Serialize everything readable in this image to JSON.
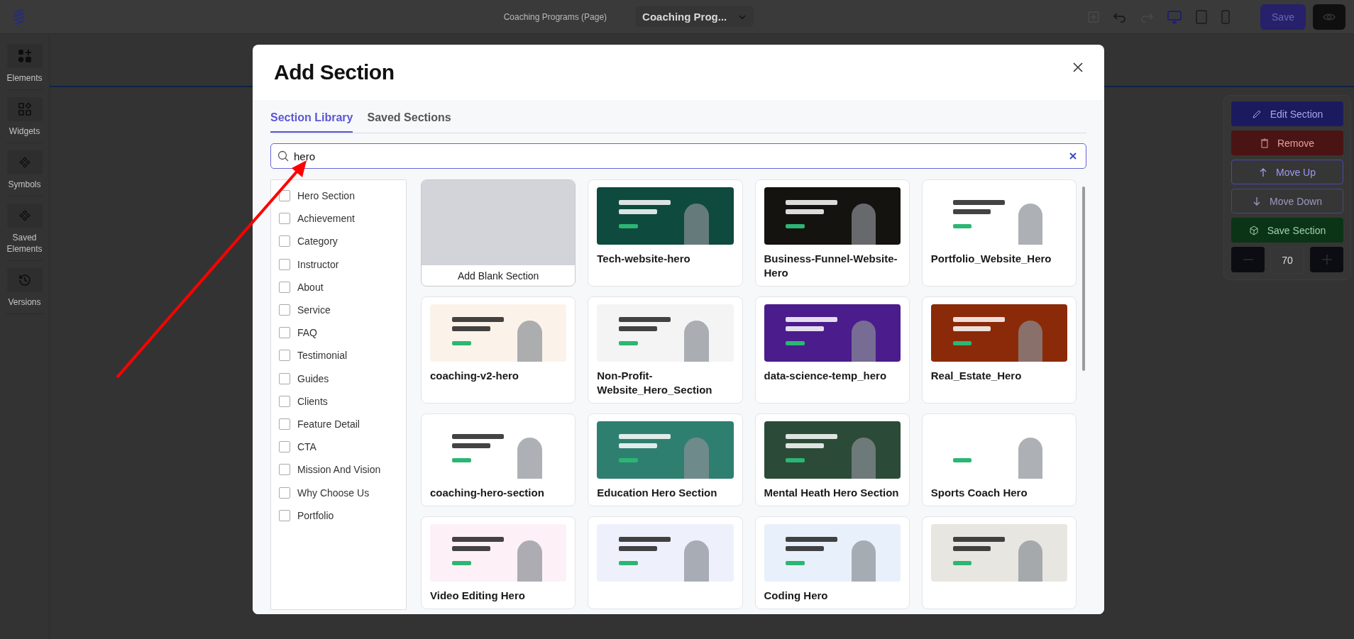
{
  "top_bar": {
    "page_label": "Coaching Programs (Page)",
    "page_select": "Coaching Prog...",
    "save_button": "Save"
  },
  "sidebar": {
    "items": [
      {
        "label": "Elements"
      },
      {
        "label": "Widgets"
      },
      {
        "label": "Symbols"
      },
      {
        "label": "Saved Elements"
      },
      {
        "label": "Versions"
      }
    ]
  },
  "section_panel": {
    "buttons": [
      {
        "label": "Edit Section",
        "kind": "edit"
      },
      {
        "label": "Remove",
        "kind": "remove"
      },
      {
        "label": "Move Up",
        "kind": "up"
      },
      {
        "label": "Move Down",
        "kind": "down"
      },
      {
        "label": "Save Section",
        "kind": "save"
      }
    ],
    "width_value": "70"
  },
  "modal": {
    "title": "Add Section",
    "tabs": [
      {
        "label": "Section Library",
        "selected": true
      },
      {
        "label": "Saved Sections",
        "selected": false
      }
    ],
    "search": {
      "value": "hero"
    },
    "categories": [
      {
        "label": "Hero Section",
        "checked": false
      },
      {
        "label": "Achievement",
        "checked": false
      },
      {
        "label": "Category",
        "checked": false
      },
      {
        "label": "Instructor",
        "checked": false
      },
      {
        "label": "About",
        "checked": false
      },
      {
        "label": "Service",
        "checked": false
      },
      {
        "label": "FAQ",
        "checked": false
      },
      {
        "label": "Testimonial",
        "checked": false
      },
      {
        "label": "Guides",
        "checked": false
      },
      {
        "label": "Clients",
        "checked": false
      },
      {
        "label": "Feature Detail",
        "checked": false
      },
      {
        "label": "CTA",
        "checked": false
      },
      {
        "label": "Mission And Vision",
        "checked": false
      },
      {
        "label": "Why Choose Us",
        "checked": false
      },
      {
        "label": "Portfolio",
        "checked": false
      }
    ],
    "blank_section": "Add Blank Section",
    "templates": [
      {
        "kind": "titled",
        "title": "Tech-website-hero"
      },
      {
        "kind": "titled",
        "title": "Business-Funnel-Website-Hero"
      },
      {
        "kind": "titled",
        "title": "Portfolio_Website_Hero"
      },
      {
        "kind": "titled",
        "title": "coaching-v2-hero"
      },
      {
        "kind": "titled",
        "title": "Non-Profit-Website_Hero_Section"
      },
      {
        "kind": "titled",
        "title": "data-science-temp_hero"
      },
      {
        "kind": "titled",
        "title": "Real_Estate_Hero"
      },
      {
        "kind": "titled",
        "title": "coaching-hero-section"
      },
      {
        "kind": "titled",
        "title": "Education Hero Section"
      },
      {
        "kind": "titled",
        "title": "Mental Heath Hero Section"
      },
      {
        "kind": "titled",
        "title": "Sports Coach Hero"
      },
      {
        "kind": "titled",
        "title": "Video Editing Hero"
      },
      {
        "kind": "cut_off"
      },
      {
        "kind": "titled",
        "title": "Coding Hero"
      },
      {
        "kind": "cut_off"
      }
    ]
  }
}
